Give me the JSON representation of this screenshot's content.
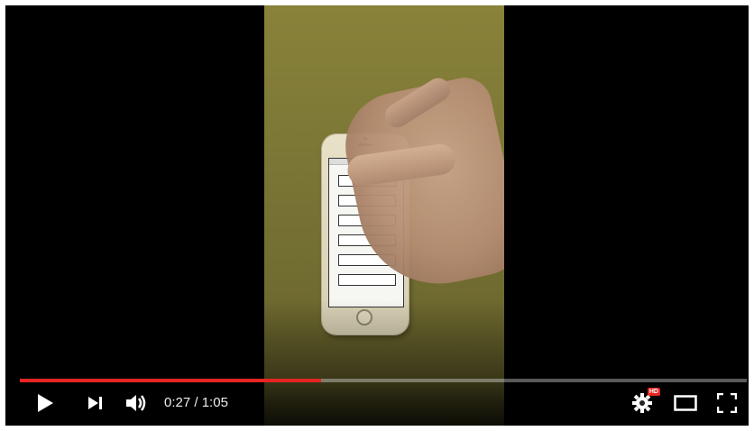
{
  "player": {
    "time": {
      "current": "0:27",
      "separator": " / ",
      "duration": "1:05"
    },
    "progress_fraction": 0.415,
    "colors": {
      "progress_played": "#e52521",
      "background": "#000000",
      "hd_badge": "#e52521"
    },
    "controls": {
      "play_icon": "play-icon",
      "next_icon": "next-icon",
      "volume_icon": "volume-icon",
      "settings_icon": "settings-gear-icon",
      "settings_badge": "HD",
      "theater_icon": "theater-mode-icon",
      "fullscreen_icon": "fullscreen-icon"
    }
  }
}
